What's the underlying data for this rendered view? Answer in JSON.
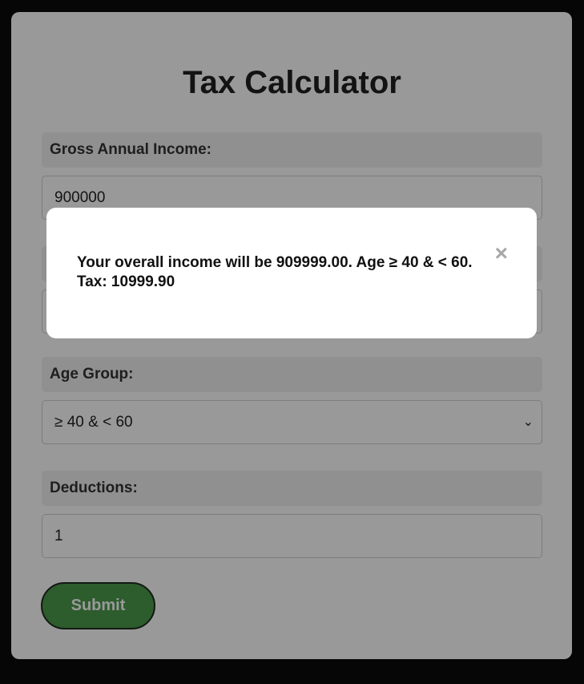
{
  "app": {
    "title": "Tax Calculator"
  },
  "form": {
    "income": {
      "label": "Gross Annual Income:",
      "value": "900000"
    },
    "age": {
      "label": "Age Group:",
      "selected": "≥ 40 & < 60",
      "caret": "⌄"
    },
    "deductions": {
      "label": "Deductions:",
      "value": "1"
    },
    "submit_label": "Submit"
  },
  "modal": {
    "message": "Your overall income will be 909999.00. Age ≥ 40 & < 60. Tax: 10999.90",
    "close_glyph": "×",
    "close_icon": "close-icon"
  },
  "colors": {
    "background": "#0a0a0a",
    "card": "#ffffff",
    "label_bg": "#f0f0f0",
    "submit": "#4c9a4c",
    "overlay": "rgba(0,0,0,0.4)"
  }
}
